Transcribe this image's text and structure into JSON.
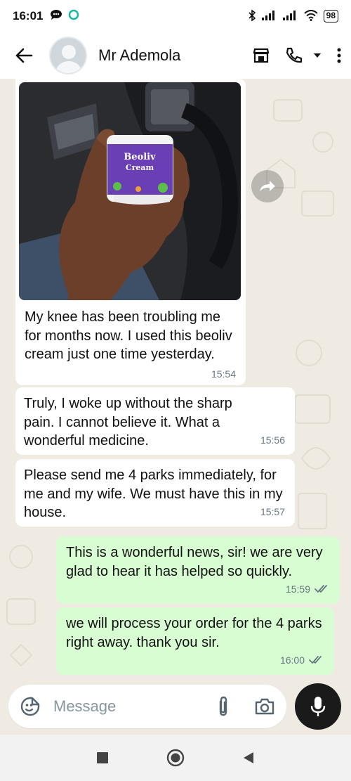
{
  "status_bar": {
    "time": "16:01",
    "battery": "98"
  },
  "header": {
    "contact_name": "Mr Ademola"
  },
  "messages": [
    {
      "direction": "in",
      "type": "image",
      "product_label": "Beoliv Cream",
      "text": "My knee has been troubling me for months now. I used this beoliv cream just one time yesterday.",
      "time": "15:54"
    },
    {
      "direction": "in",
      "text": "Truly, I woke up without the sharp pain. I cannot believe it. What a wonderful medicine.",
      "time": "15:56"
    },
    {
      "direction": "in",
      "text": "Please send me 4 parks immediately, for me and my wife. We must have this in my house.",
      "time": "15:57"
    },
    {
      "direction": "out",
      "text": "This is a wonderful news, sir! we are very glad to hear it has helped so quickly.",
      "time": "15:59",
      "status": "read"
    },
    {
      "direction": "out",
      "text": "we will process your order for the 4 parks right away. thank you sir.",
      "time": "16:00",
      "status": "read"
    }
  ],
  "composer": {
    "placeholder": "Message"
  },
  "colors": {
    "chat_background": "#efeae2",
    "incoming_bubble": "#ffffff",
    "outgoing_bubble": "#d9fdd3",
    "read_tick": "#667781",
    "mic_button": "#1a1a1a"
  }
}
